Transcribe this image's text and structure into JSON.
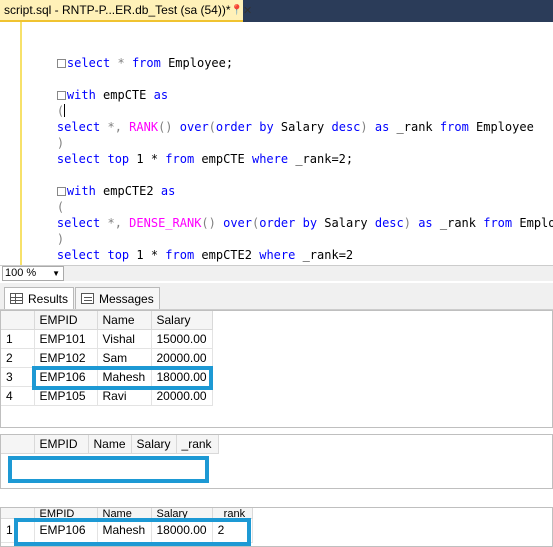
{
  "doc_tab": {
    "title": "script.sql - RNTP-P...ER.db_Test (sa (54))*",
    "pin": "📍",
    "close": "✕"
  },
  "colors": {
    "highlight": "#1d99d4",
    "keyword": "#0000ff",
    "function": "#ff00ff",
    "tab_active": "#fff1b8"
  },
  "editor": {
    "line1": {
      "t1": "select",
      "t2": " * ",
      "t3": "from",
      "t4": " Employee;"
    },
    "line3": {
      "t1": "with",
      "t2": " empCTE ",
      "t3": "as"
    },
    "line4": {
      "t1": "("
    },
    "line5": {
      "t1": "select",
      "t2": " *, ",
      "t3": "RANK",
      "t4": "() ",
      "t5": "over",
      "t6": "(",
      "t7": "order by",
      "t8": " Salary ",
      "t9": "desc",
      "t10": ") ",
      "t11": "as",
      "t12": " _rank ",
      "t13": "from",
      "t14": " Employee"
    },
    "line6": {
      "t1": ")"
    },
    "line7": {
      "t1": "select top",
      "t2": " 1 * ",
      "t3": "from",
      "t4": " empCTE ",
      "t5": "where",
      "t6": " _rank=2;"
    },
    "line9": {
      "t1": "with",
      "t2": " empCTE2 ",
      "t3": "as"
    },
    "line10": {
      "t1": "("
    },
    "line11": {
      "t1": "select",
      "t2": " *, ",
      "t3": "DENSE_RANK",
      "t4": "() ",
      "t5": "over",
      "t6": "(",
      "t7": "order by",
      "t8": " Salary ",
      "t9": "desc",
      "t10": ") ",
      "t11": "as",
      "t12": " _rank ",
      "t13": "from",
      "t14": " Employee"
    },
    "line12": {
      "t1": ")"
    },
    "line13": {
      "t1": "select top",
      "t2": " 1 * ",
      "t3": "from",
      "t4": " empCTE2 ",
      "t5": "where",
      "t6": " _rank=2"
    }
  },
  "zoom": {
    "value": "100 %",
    "arrow": "▼"
  },
  "result_tabs": {
    "results": "Results",
    "messages": "Messages"
  },
  "grid1": {
    "headers": [
      "",
      "EMPID",
      "Name",
      "Salary"
    ],
    "rows": [
      [
        "1",
        "EMP101",
        "Vishal",
        "15000.00"
      ],
      [
        "2",
        "EMP102",
        "Sam",
        "20000.00"
      ],
      [
        "3",
        "EMP106",
        "Mahesh",
        "18000.00"
      ],
      [
        "4",
        "EMP105",
        "Ravi",
        "20000.00"
      ]
    ]
  },
  "grid2": {
    "headers": [
      "",
      "EMPID",
      "Name",
      "Salary",
      "_rank"
    ]
  },
  "grid3": {
    "headers": [
      "",
      "EMPID",
      "Name",
      "Salary",
      "_rank"
    ],
    "rows": [
      [
        "1",
        "EMP106",
        "Mahesh",
        "18000.00",
        "2"
      ]
    ]
  }
}
